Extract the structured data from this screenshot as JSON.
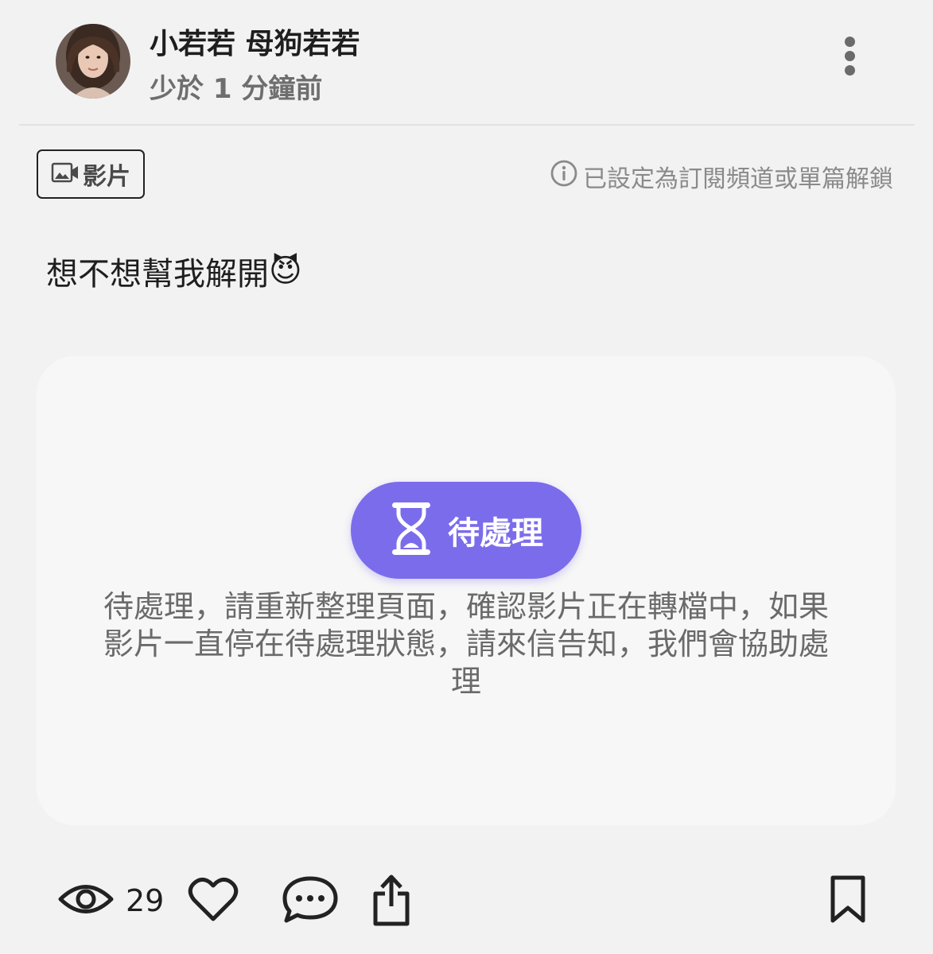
{
  "post": {
    "author_name": "小若若 母狗若若",
    "timestamp": "少於 1 分鐘前",
    "media_type_label": "影片",
    "lock_info": "已設定為訂閱頻道或單篇解鎖",
    "text": "想不想幫我解開",
    "emoji": "😈"
  },
  "video": {
    "status_label": "待處理",
    "status_message": "待處理，請重新整理頁面，確認影片正在轉檔中，如果影片一直停在待處理狀態，請來信告知，我們會協助處理"
  },
  "actions": {
    "view_count": "29"
  },
  "colors": {
    "background": "#f2f2f2",
    "card_background": "#f7f7f7",
    "status_accent": "#7b6cec",
    "text_primary": "#1e1e1e",
    "text_secondary": "#6a6a6a"
  },
  "icons": {
    "more": "more-vertical-icon",
    "video": "video-camera-icon",
    "info": "info-icon",
    "status": "hourglass-icon",
    "views": "eye-icon",
    "like": "heart-icon",
    "comment": "comment-bubble-icon",
    "share": "share-icon",
    "bookmark": "bookmark-icon"
  }
}
